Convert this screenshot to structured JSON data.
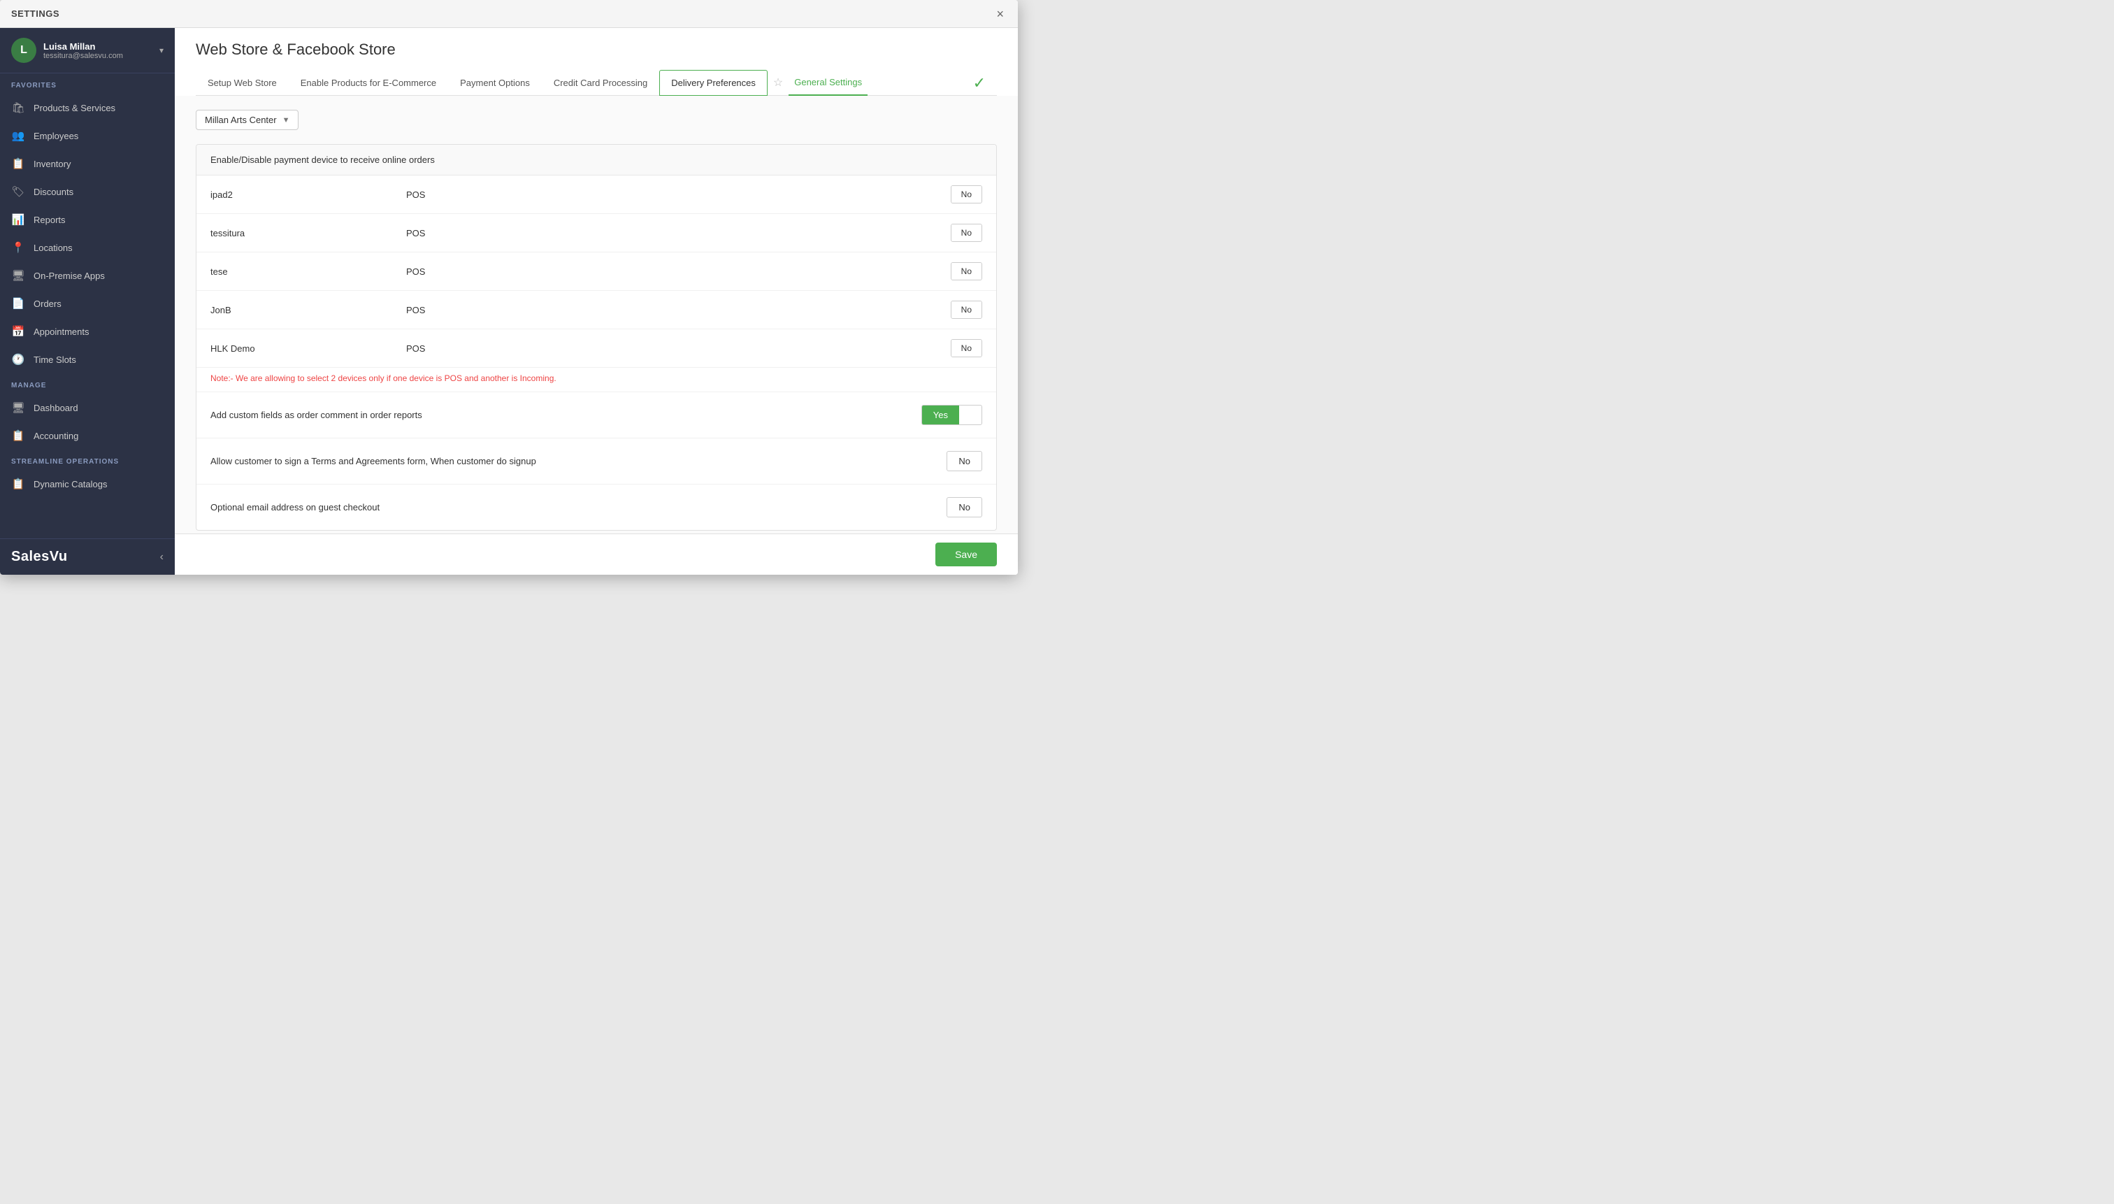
{
  "modal": {
    "title": "SETTINGS",
    "close_label": "×"
  },
  "sidebar": {
    "user": {
      "initial": "L",
      "name": "Luisa Millan",
      "email": "tessitura@salesvu.com"
    },
    "sections": {
      "favorites_label": "FAVORITES",
      "manage_label": "MANAGE",
      "streamline_label": "STREAMLINE OPERATIONS"
    },
    "favorites_items": [
      {
        "label": "Products & Services",
        "icon": "🛍"
      },
      {
        "label": "Employees",
        "icon": "👥"
      },
      {
        "label": "Inventory",
        "icon": "📋"
      },
      {
        "label": "Discounts",
        "icon": "🏷"
      },
      {
        "label": "Reports",
        "icon": "📊"
      },
      {
        "label": "Locations",
        "icon": "📍"
      },
      {
        "label": "On-Premise Apps",
        "icon": "🖥"
      },
      {
        "label": "Orders",
        "icon": "📄"
      },
      {
        "label": "Appointments",
        "icon": "📅"
      },
      {
        "label": "Time Slots",
        "icon": "🕐"
      }
    ],
    "manage_items": [
      {
        "label": "Dashboard",
        "icon": "🖥"
      },
      {
        "label": "Accounting",
        "icon": "📋"
      }
    ],
    "streamline_items": [
      {
        "label": "Dynamic Catalogs",
        "icon": "📋"
      }
    ],
    "logo": "SalesVu",
    "collapse_icon": "‹"
  },
  "content": {
    "page_title": "Web Store & Facebook Store",
    "tabs": [
      {
        "label": "Setup Web Store",
        "active": false
      },
      {
        "label": "Enable Products for E-Commerce",
        "active": false
      },
      {
        "label": "Payment Options",
        "active": false
      },
      {
        "label": "Credit Card Processing",
        "active": false
      },
      {
        "label": "Delivery Preferences",
        "active": true
      },
      {
        "label": "General Settings",
        "active": false,
        "special": "green"
      }
    ],
    "location_dropdown": {
      "value": "Millan Arts Center",
      "arrow": "▼"
    },
    "section_header": "Enable/Disable payment device to receive online orders",
    "devices": [
      {
        "name": "ipad2",
        "type": "POS",
        "value": "No"
      },
      {
        "name": "tessitura",
        "type": "POS",
        "value": "No"
      },
      {
        "name": "tese",
        "type": "POS",
        "value": "No"
      },
      {
        "name": "JonB",
        "type": "POS",
        "value": "No"
      },
      {
        "name": "HLK Demo",
        "type": "POS",
        "value": "No"
      }
    ],
    "note": "Note:- We are allowing to select 2 devices only if one device is POS and another is Incoming.",
    "settings_rows": [
      {
        "label": "Add custom fields as order comment in order reports",
        "value": "Yes",
        "type": "yes-no"
      },
      {
        "label": "Allow customer to sign a Terms and Agreements form, When customer do signup",
        "value": "No",
        "type": "no-only"
      },
      {
        "label": "Optional email address on guest checkout",
        "value": "No",
        "type": "no-only"
      }
    ],
    "save_button": "Save"
  }
}
